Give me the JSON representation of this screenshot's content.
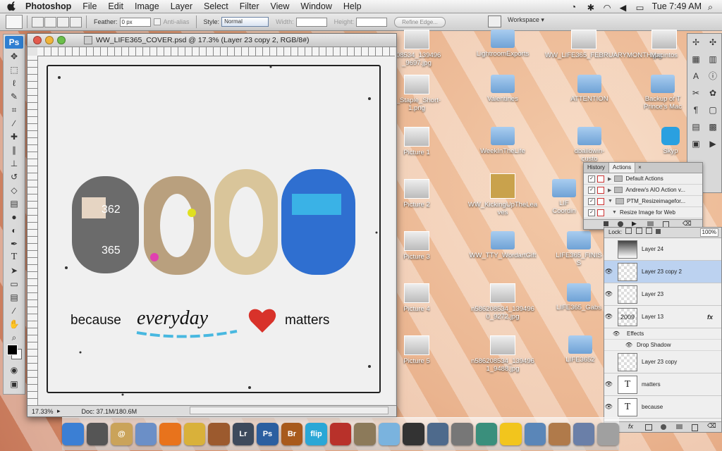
{
  "menubar": {
    "app": "Photoshop",
    "items": [
      "File",
      "Edit",
      "Image",
      "Layer",
      "Select",
      "Filter",
      "View",
      "Window",
      "Help"
    ],
    "clock": "Tue 7:49 AM"
  },
  "options": {
    "feather_label": "Feather:",
    "feather_value": "0 px",
    "antialias_label": "Anti-alias",
    "style_label": "Style:",
    "style_value": "Normal",
    "width_label": "Width:",
    "height_label": "Height:",
    "refine_label": "Refine Edge...",
    "workspace_label": "Workspace"
  },
  "tools": {
    "ps_label": "Ps",
    "items": [
      "move",
      "marquee",
      "lasso",
      "quick-select",
      "crop",
      "eyedropper",
      "healing",
      "brush",
      "stamp",
      "history-brush",
      "eraser",
      "gradient",
      "blur",
      "dodge",
      "pen",
      "type",
      "path-select",
      "shape",
      "notes",
      "eyedropper2",
      "hand",
      "zoom"
    ]
  },
  "document": {
    "title": "WW_LIFE365_COVER.psd @ 17.3% (Layer 23 copy 2, RGB/8#)",
    "zoom": "17.33%",
    "doc_info": "Doc: 37.1M/180.6M",
    "artwork_year": "2009",
    "tagline_pre": "because",
    "tagline_mid": "everyday",
    "tagline_post": "matters",
    "year_overlay_1": "362",
    "year_overlay_2": "365"
  },
  "desktop": {
    "icons": [
      {
        "label": "208534_139496\n_9697.jpg",
        "kind": "thumb"
      },
      {
        "label": "LightroomExports",
        "kind": "folder"
      },
      {
        "label": "WW_LIFE365_FEBRUARYMONTH.jpg",
        "kind": "thumb"
      },
      {
        "label": "Macintos",
        "kind": "drive"
      },
      {
        "label": "y_Staple_Short-\n1.png",
        "kind": "thumb"
      },
      {
        "label": "Valentines",
        "kind": "folder"
      },
      {
        "label": "ATTENTION",
        "kind": "folder"
      },
      {
        "label": "Backup of T\nPrince's Mac",
        "kind": "folder"
      },
      {
        "label": "Picture 1",
        "kind": "thumb"
      },
      {
        "label": "WeekInTheLife",
        "kind": "folder"
      },
      {
        "label": "dballdwin-\ncusto",
        "kind": "folder"
      },
      {
        "label": "Skyp",
        "kind": "app"
      },
      {
        "label": "Picture 2",
        "kind": "thumb"
      },
      {
        "label": "WW_KickingUpTheLea\nves",
        "kind": "thumb"
      },
      {
        "label": "LIF\nCoordin",
        "kind": "folder"
      },
      {
        "label": "Picture 3",
        "kind": "thumb"
      },
      {
        "label": "WW_TTY_WordartGift",
        "kind": "folder"
      },
      {
        "label": "LIFE365_FINIS\nS",
        "kind": "folder"
      },
      {
        "label": "Picture 4",
        "kind": "thumb"
      },
      {
        "label": "n586208534_139496\n0_9272.jpg",
        "kind": "thumb"
      },
      {
        "label": "LIFE365_Gabs",
        "kind": "folder"
      },
      {
        "label": "Picture 5",
        "kind": "thumb"
      },
      {
        "label": "n586208534_139496\n1_9488.jpg",
        "kind": "thumb"
      },
      {
        "label": "LIFE3652",
        "kind": "folder"
      }
    ]
  },
  "actions": {
    "tabs": [
      "History",
      "Actions"
    ],
    "rows": [
      {
        "label": "Default Actions",
        "checked": true
      },
      {
        "label": "Andrew's AIO Action v...",
        "checked": true
      },
      {
        "label": "PTM_Resizeimagefor...",
        "checked": true
      },
      {
        "label": "Resize Image for Web",
        "checked": true
      }
    ]
  },
  "layers": {
    "lock_label": "Lock:",
    "opacity": "100%",
    "fill": "100%",
    "rows": [
      {
        "name": "Layer 24",
        "thumb": "",
        "visible": false
      },
      {
        "name": "Layer 23 copy 2",
        "thumb": "",
        "visible": true,
        "selected": true
      },
      {
        "name": "Layer 23",
        "thumb": "",
        "visible": true
      },
      {
        "name": "Layer 13",
        "thumb": "2009",
        "visible": true,
        "fx": "fx"
      },
      {
        "name": "Effects",
        "sub": true
      },
      {
        "name": "Drop Shadow",
        "sub": true
      },
      {
        "name": "Layer 23 copy",
        "thumb": "",
        "visible": false
      },
      {
        "name": "matters",
        "thumb": "T",
        "visible": true
      },
      {
        "name": "because",
        "thumb": "T",
        "visible": true
      }
    ]
  },
  "dock": {
    "items": [
      {
        "label": "",
        "color": "#3b7fd4"
      },
      {
        "label": "",
        "color": "#555555"
      },
      {
        "label": "@",
        "color": "#caa35a"
      },
      {
        "label": "",
        "color": "#6b8fc7"
      },
      {
        "label": "",
        "color": "#e8731c"
      },
      {
        "label": "",
        "color": "#d9b13a"
      },
      {
        "label": "",
        "color": "#9c5a2e"
      },
      {
        "label": "Lr",
        "color": "#3d4a5c"
      },
      {
        "label": "Ps",
        "color": "#2c5fa0"
      },
      {
        "label": "Br",
        "color": "#a85a1c"
      },
      {
        "label": "flip",
        "color": "#2aa7d6"
      },
      {
        "label": "",
        "color": "#b8312a"
      },
      {
        "label": "",
        "color": "#8c7a5a"
      },
      {
        "label": "",
        "color": "#7ab3de"
      },
      {
        "label": "",
        "color": "#333333"
      },
      {
        "label": "",
        "color": "#4e6a8c"
      },
      {
        "label": "",
        "color": "#777777"
      },
      {
        "label": "",
        "color": "#3a8f7c"
      },
      {
        "label": "",
        "color": "#f2c51d"
      },
      {
        "label": "",
        "color": "#5a86b8"
      },
      {
        "label": "",
        "color": "#b07a4a"
      },
      {
        "label": "",
        "color": "#6a7fa8"
      },
      {
        "label": "",
        "color": "#a0a0a0"
      }
    ]
  },
  "colors": {
    "accent": "#2f7fd2",
    "selection": "#bcd2f0",
    "heart": "#d8322a",
    "underline": "#48b8e0"
  }
}
